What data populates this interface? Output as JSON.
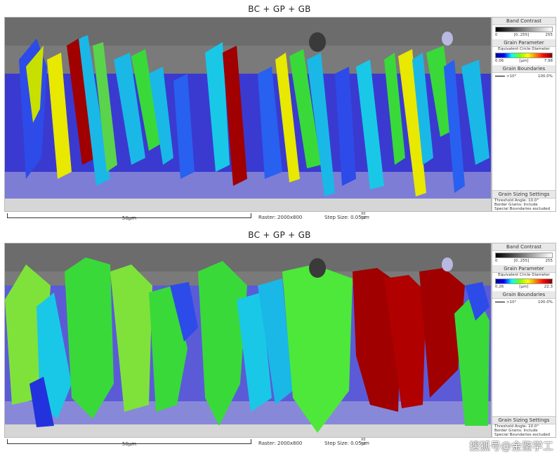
{
  "panels": [
    {
      "title": "BC + GP + GB",
      "band_contrast": {
        "title": "Band Contrast",
        "min": "0",
        "range": "[0..255]",
        "max": "255"
      },
      "grain_parameter": {
        "title": "Grain Parameter",
        "subtitle": "Equivalent Circle Diameter",
        "min": "0.06",
        "unit": "[µm]",
        "max": "7.98"
      },
      "grain_boundaries": {
        "title": "Grain Boundaries",
        "threshold": ">10°",
        "value": "100.0%"
      },
      "sizing": {
        "title": "Grain Sizing Settings",
        "line1": "Threshold Angle: 10.0°",
        "line2": "Border Grains: Include",
        "line3": "Special Boundaries excluded"
      },
      "footer": {
        "scale": "50µm",
        "raster": "Raster: 2000x800",
        "step": "Step Size: 0.05µm",
        "axis_x": "X0",
        "axis_y": "Y0"
      }
    },
    {
      "title": "BC + GP + GB",
      "band_contrast": {
        "title": "Band Contrast",
        "min": "0",
        "range": "[0..255]",
        "max": "255"
      },
      "grain_parameter": {
        "title": "Grain Parameter",
        "subtitle": "Equivalent Circle Diameter",
        "min": "0.26",
        "unit": "[µm]",
        "max": "22.3"
      },
      "grain_boundaries": {
        "title": "Grain Boundaries",
        "threshold": ">10°",
        "value": "100.0%"
      },
      "sizing": {
        "title": "Grain Sizing Settings",
        "line1": "Threshold Angle: 10.0°",
        "line2": "Border Grains: Include",
        "line3": "Special Boundaries excluded"
      },
      "footer": {
        "scale": "50µm",
        "raster": "Raster: 2000x800",
        "step": "Step Size: 0.05µm",
        "axis_x": "X0",
        "axis_y": "Y0"
      }
    }
  ],
  "watermark": "搜狐号@金鉴学工",
  "colors": {
    "dark_red": "#a00000",
    "green": "#3ad93a",
    "cyan": "#19c8e6",
    "blue": "#2233dd",
    "yellow": "#e8e800"
  }
}
